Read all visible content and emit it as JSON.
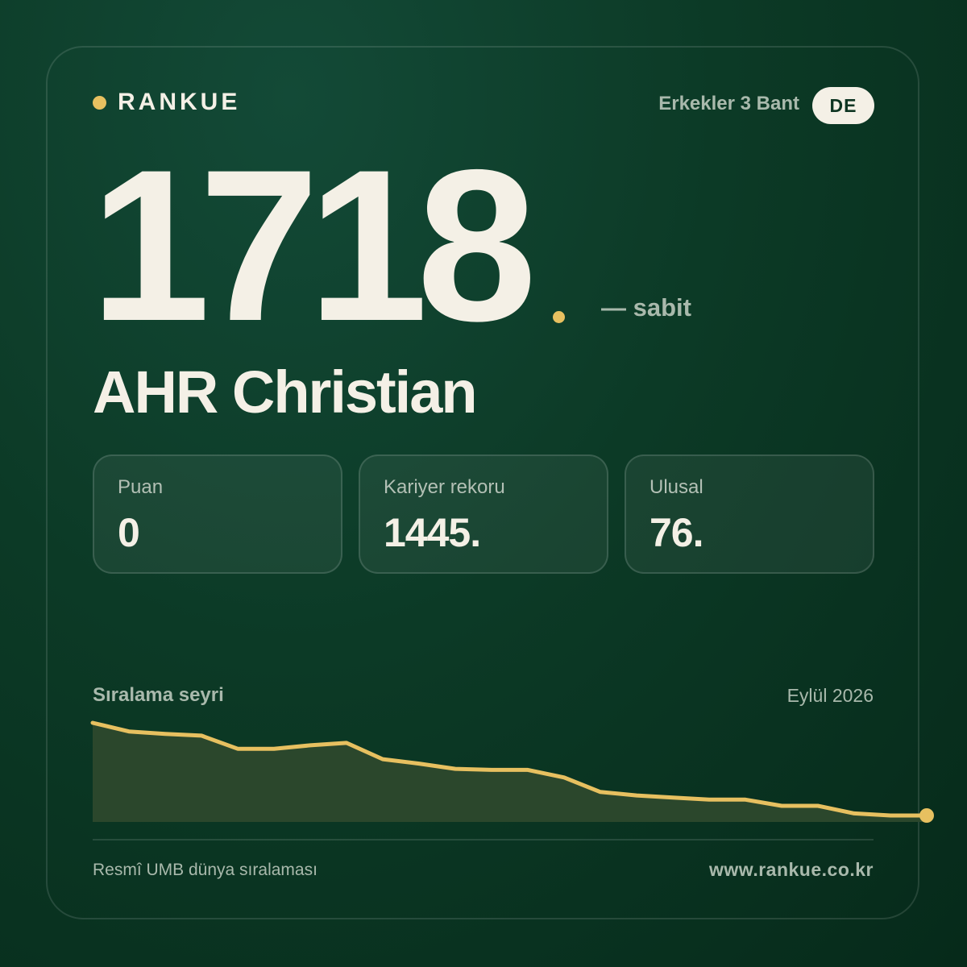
{
  "brand": {
    "name": "RANKUE",
    "accent_color": "#e7c060"
  },
  "header": {
    "category": "Erkekler 3 Bant",
    "country": "DE"
  },
  "rank": {
    "value": "1718",
    "trend": "— sabit"
  },
  "player": {
    "name": "AHR Christian"
  },
  "stats": [
    {
      "label": "Puan",
      "value": "0"
    },
    {
      "label": "Kariyer rekoru",
      "value": "1445."
    },
    {
      "label": "Ulusal",
      "value": "76."
    }
  ],
  "chart": {
    "title": "Sıralama seyri",
    "period": "Eylül 2026"
  },
  "chart_data": {
    "type": "area",
    "title": "",
    "y_meaning": "rank (higher rank value shown lower, inverted axis)",
    "values": [
      1450,
      1475,
      1482,
      1487,
      1525,
      1525,
      1515,
      1508,
      1555,
      1568,
      1583,
      1586,
      1586,
      1608,
      1650,
      1660,
      1666,
      1672,
      1672,
      1690,
      1690,
      1712,
      1718,
      1718
    ],
    "ylim": [
      1450,
      1718
    ],
    "inverted": true,
    "line_color": "#e7c060",
    "fill_color": "#2b472c"
  },
  "footer": {
    "source": "Resmî UMB dünya sıralaması",
    "url": "www.rankue.co.kr"
  }
}
